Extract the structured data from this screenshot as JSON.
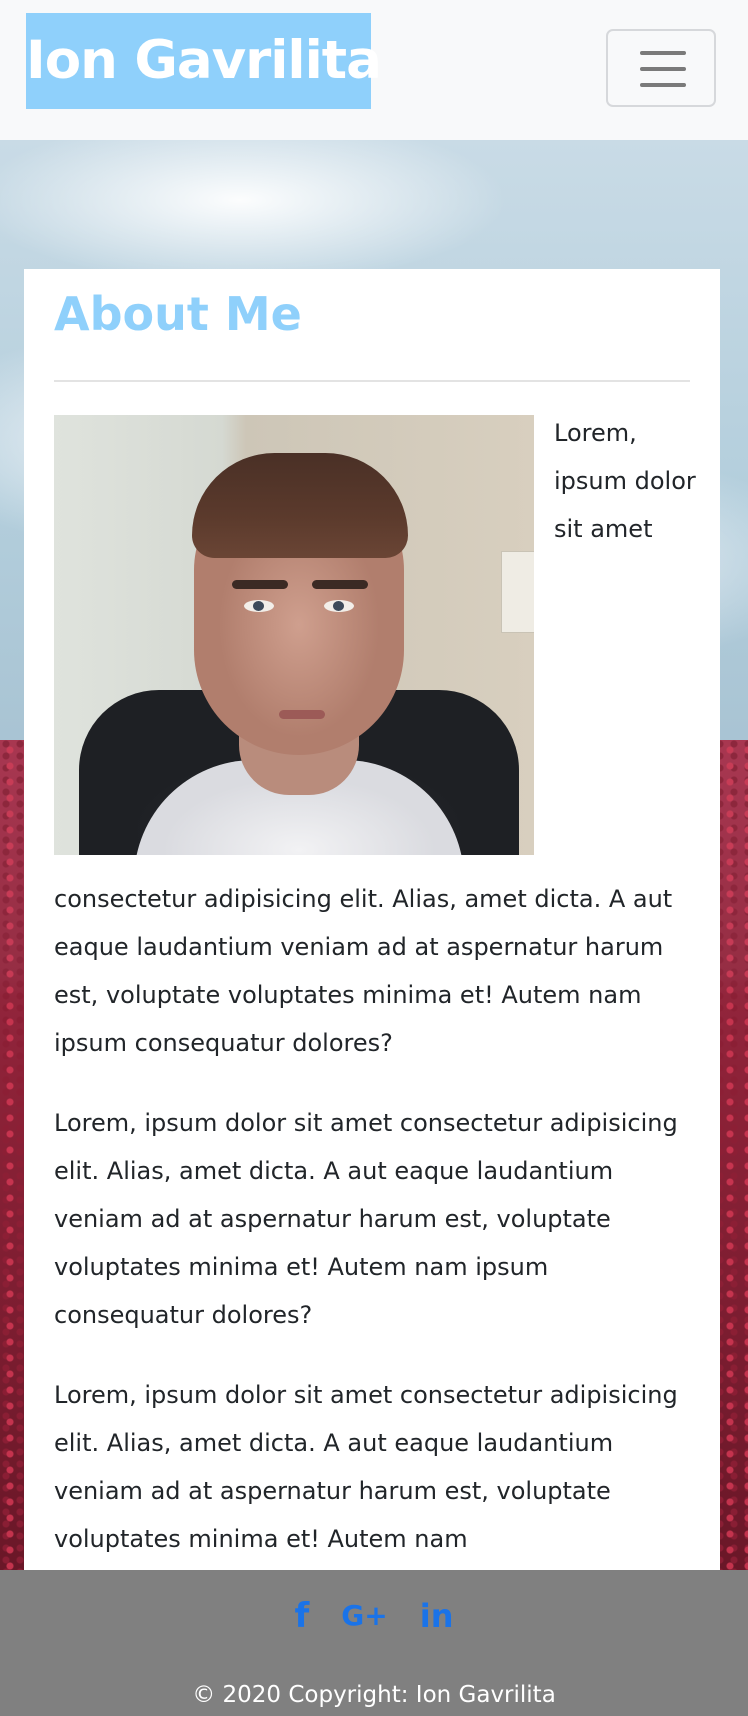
{
  "navbar": {
    "brand": "Ion Gavrilita",
    "toggler_icon": "hamburger-menu-icon"
  },
  "about": {
    "heading": "About Me",
    "photo_alt": "Portrait photo",
    "lead": "Lorem, ipsum dolor sit amet",
    "lead_continuation": "consectetur adipisicing elit. Alias, amet dicta. A aut eaque laudantium veniam ad at aspernatur harum est, voluptate voluptates minima et! Autem nam ipsum consequatur dolores?",
    "paragraph2": "Lorem, ipsum dolor sit amet consectetur adipisicing elit. Alias, amet dicta. A aut eaque laudantium veniam ad at aspernatur harum est, voluptate voluptates minima et! Autem nam ipsum consequatur dolores?",
    "paragraph3": "Lorem, ipsum dolor sit amet consectetur adipisicing elit. Alias, amet dicta. A aut eaque laudantium veniam ad at aspernatur harum est, voluptate voluptates minima et! Autem nam"
  },
  "footer": {
    "social": [
      {
        "name": "facebook-icon",
        "glyph": "f"
      },
      {
        "name": "google-plus-icon",
        "glyph": "G+"
      },
      {
        "name": "linkedin-icon",
        "glyph": "in"
      }
    ],
    "copyright": "© 2020 Copyright: Ion Gavrilita"
  },
  "colors": {
    "brand_background": "#8fd0fb",
    "heading": "#8fd0fb",
    "footer_background": "#808080",
    "social_icon": "#1a73e8"
  }
}
